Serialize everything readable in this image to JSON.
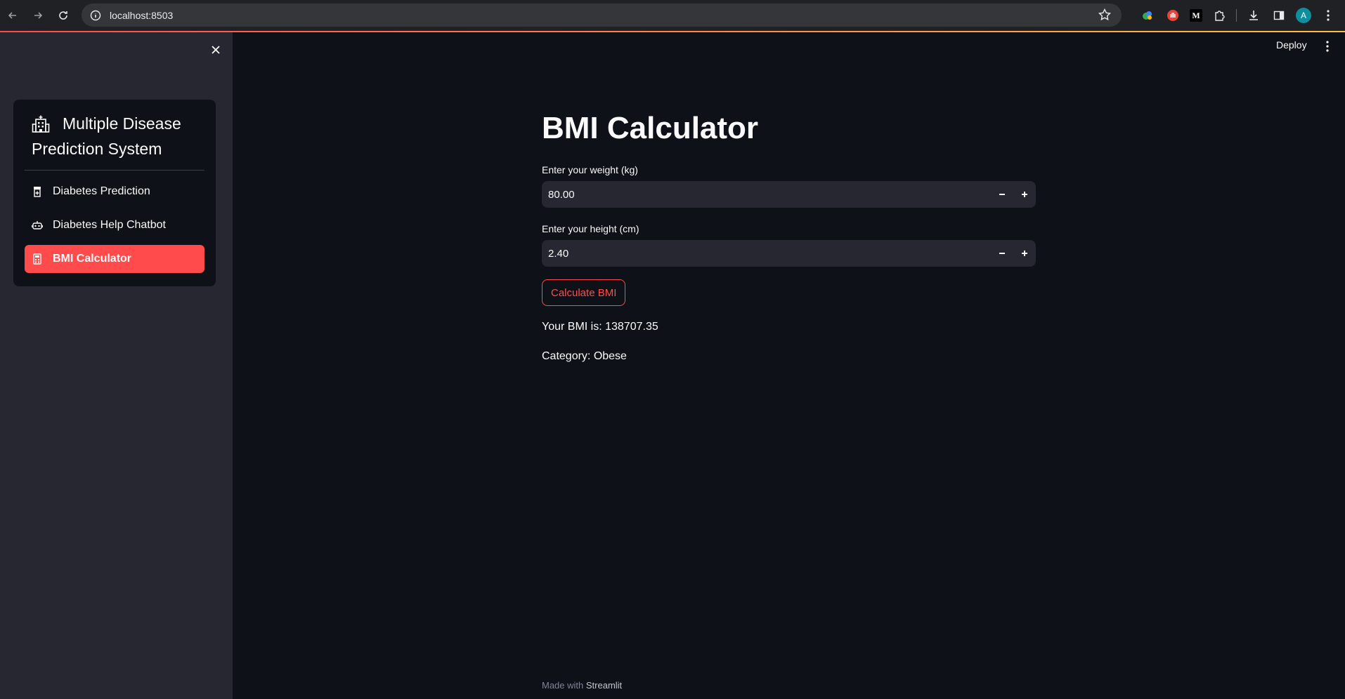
{
  "browser": {
    "url": "localhost:8503",
    "avatar_letter": "A",
    "m_extension": "M"
  },
  "sidebar": {
    "title_line1": "Multiple Disease",
    "title_line2": "Prediction System",
    "items": [
      {
        "label": "Diabetes Prediction",
        "icon": "pill-bottle-icon",
        "active": false
      },
      {
        "label": "Diabetes Help Chatbot",
        "icon": "robot-icon",
        "active": false
      },
      {
        "label": "BMI Calculator",
        "icon": "calculator-icon",
        "active": true
      }
    ]
  },
  "header": {
    "deploy_label": "Deploy"
  },
  "main": {
    "title": "BMI Calculator",
    "weight_label": "Enter your weight (kg)",
    "weight_value": "80.00",
    "height_label": "Enter your height (cm)",
    "height_value": "2.40",
    "button_label": "Calculate BMI",
    "bmi_result": "Your BMI is: 138707.35",
    "category_result": "Category: Obese"
  },
  "footer": {
    "prefix": "Made with",
    "brand": "Streamlit"
  },
  "colors": {
    "accent": "#ff4b4b",
    "background": "#0e1117",
    "sidebar": "#262730"
  }
}
